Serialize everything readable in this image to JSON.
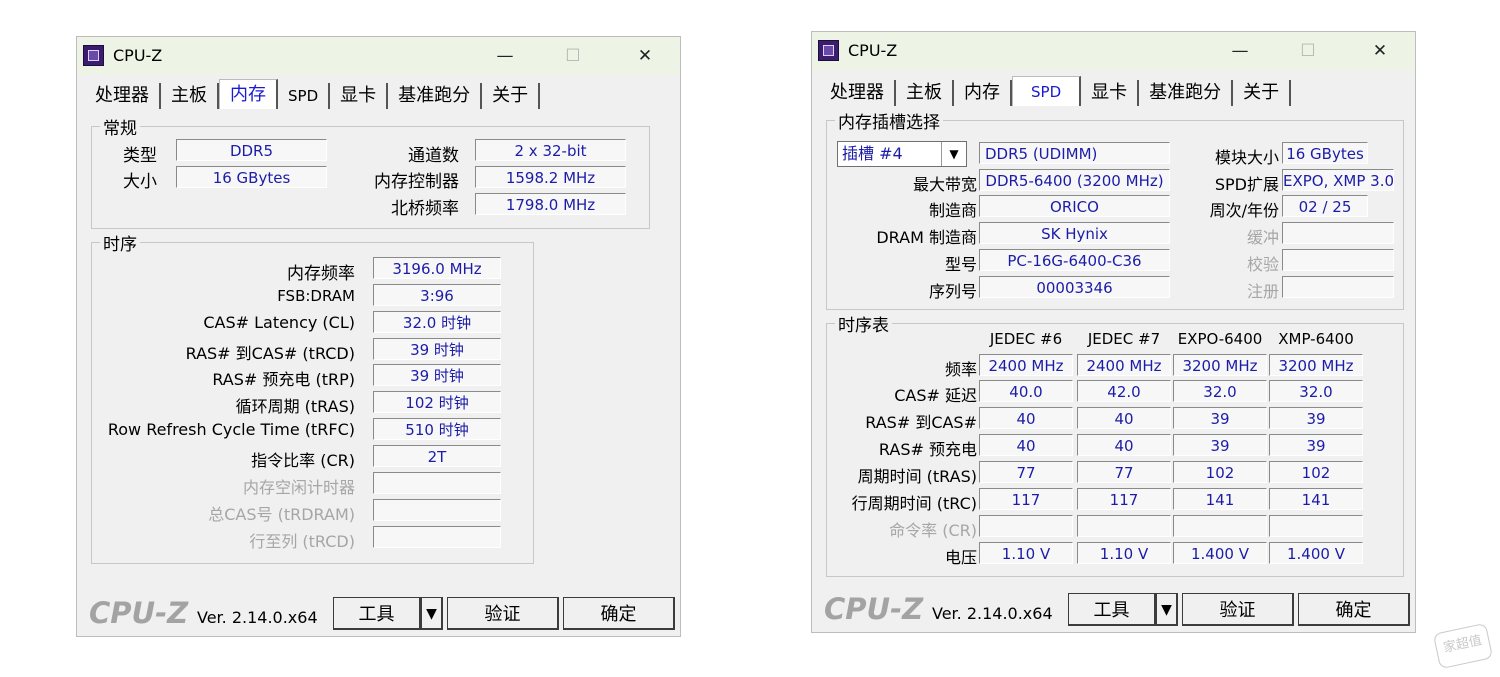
{
  "window1": {
    "title": "CPU-Z",
    "tabs": [
      "处理器",
      "主板",
      "内存",
      "SPD",
      "显卡",
      "基准跑分",
      "关于"
    ],
    "active_tab": "内存",
    "general": {
      "title": "常规",
      "type_label": "类型",
      "type_value": "DDR5",
      "size_label": "大小",
      "size_value": "16 GBytes",
      "channels_label": "通道数",
      "channels_value": "2 x 32-bit",
      "mem_ctrl_label": "内存控制器",
      "mem_ctrl_value": "1598.2 MHz",
      "nb_freq_label": "北桥频率",
      "nb_freq_value": "1798.0 MHz"
    },
    "timings": {
      "title": "时序",
      "rows": [
        {
          "label": "内存频率",
          "value": "3196.0 MHz",
          "disabled": false
        },
        {
          "label": "FSB:DRAM",
          "value": "3:96",
          "disabled": false
        },
        {
          "label": "CAS# Latency (CL)",
          "value": "32.0 时钟",
          "disabled": false
        },
        {
          "label": "RAS# 到CAS# (tRCD)",
          "value": "39 时钟",
          "disabled": false
        },
        {
          "label": "RAS# 预充电 (tRP)",
          "value": "39 时钟",
          "disabled": false
        },
        {
          "label": "循环周期 (tRAS)",
          "value": "102 时钟",
          "disabled": false
        },
        {
          "label": "Row Refresh Cycle Time (tRFC)",
          "value": "510 时钟",
          "disabled": false
        },
        {
          "label": "指令比率 (CR)",
          "value": "2T",
          "disabled": false
        },
        {
          "label": "内存空闲计时器",
          "value": "",
          "disabled": true
        },
        {
          "label": "总CAS号 (tRDRAM)",
          "value": "",
          "disabled": true
        },
        {
          "label": "行至列 (tRCD)",
          "value": "",
          "disabled": true
        }
      ]
    },
    "footer": {
      "logo": "CPU-Z",
      "version": "Ver. 2.14.0.x64",
      "tools_label": "工具",
      "dropdown_glyph": "▼",
      "validate_label": "验证",
      "ok_label": "确定"
    }
  },
  "window2": {
    "title": "CPU-Z",
    "tabs": [
      "处理器",
      "主板",
      "内存",
      "SPD",
      "显卡",
      "基准跑分",
      "关于"
    ],
    "active_tab": "SPD",
    "slot": {
      "title": "内存插槽选择",
      "slot_selected": "插槽 #4",
      "type_value": "DDR5 (UDIMM)",
      "module_size_label": "模块大小",
      "module_size_value": "16 GBytes",
      "max_bw_label": "最大带宽",
      "max_bw_value": "DDR5-6400 (3200 MHz)",
      "spd_ext_label": "SPD扩展",
      "spd_ext_value": "EXPO, XMP 3.0",
      "manufacturer_label": "制造商",
      "manufacturer_value": "ORICO",
      "week_year_label": "周次/年份",
      "week_year_value": "02 / 25",
      "dram_mfr_label": "DRAM 制造商",
      "dram_mfr_value": "SK Hynix",
      "buffered_label": "缓冲",
      "buffered_value": "",
      "part_label": "型号",
      "part_value": "PC-16G-6400-C36",
      "correction_label": "校验",
      "correction_value": "",
      "serial_label": "序列号",
      "serial_value": "00003346",
      "registered_label": "注册",
      "registered_value": ""
    },
    "timing_table": {
      "title": "时序表",
      "columns": [
        "JEDEC #6",
        "JEDEC #7",
        "EXPO-6400",
        "XMP-6400"
      ],
      "rows": [
        {
          "label": "频率",
          "values": [
            "2400 MHz",
            "2400 MHz",
            "3200 MHz",
            "3200 MHz"
          ],
          "disabled": false
        },
        {
          "label": "CAS# 延迟",
          "values": [
            "40.0",
            "42.0",
            "32.0",
            "32.0"
          ],
          "disabled": false
        },
        {
          "label": "RAS# 到CAS#",
          "values": [
            "40",
            "40",
            "39",
            "39"
          ],
          "disabled": false
        },
        {
          "label": "RAS# 预充电",
          "values": [
            "40",
            "40",
            "39",
            "39"
          ],
          "disabled": false
        },
        {
          "label": "周期时间 (tRAS)",
          "values": [
            "77",
            "77",
            "102",
            "102"
          ],
          "disabled": false
        },
        {
          "label": "行周期时间 (tRC)",
          "values": [
            "117",
            "117",
            "141",
            "141"
          ],
          "disabled": false
        },
        {
          "label": "命令率 (CR)",
          "values": [
            "",
            "",
            "",
            ""
          ],
          "disabled": true
        },
        {
          "label": "电压",
          "values": [
            "1.10 V",
            "1.10 V",
            "1.400 V",
            "1.400 V"
          ],
          "disabled": false
        }
      ]
    },
    "footer": {
      "logo": "CPU-Z",
      "version": "Ver. 2.14.0.x64",
      "tools_label": "工具",
      "dropdown_glyph": "▼",
      "validate_label": "验证",
      "ok_label": "确定"
    }
  },
  "watermark": "家超值",
  "window_controls": {
    "minimize": "—",
    "maximize": "☐",
    "close": "✕"
  }
}
